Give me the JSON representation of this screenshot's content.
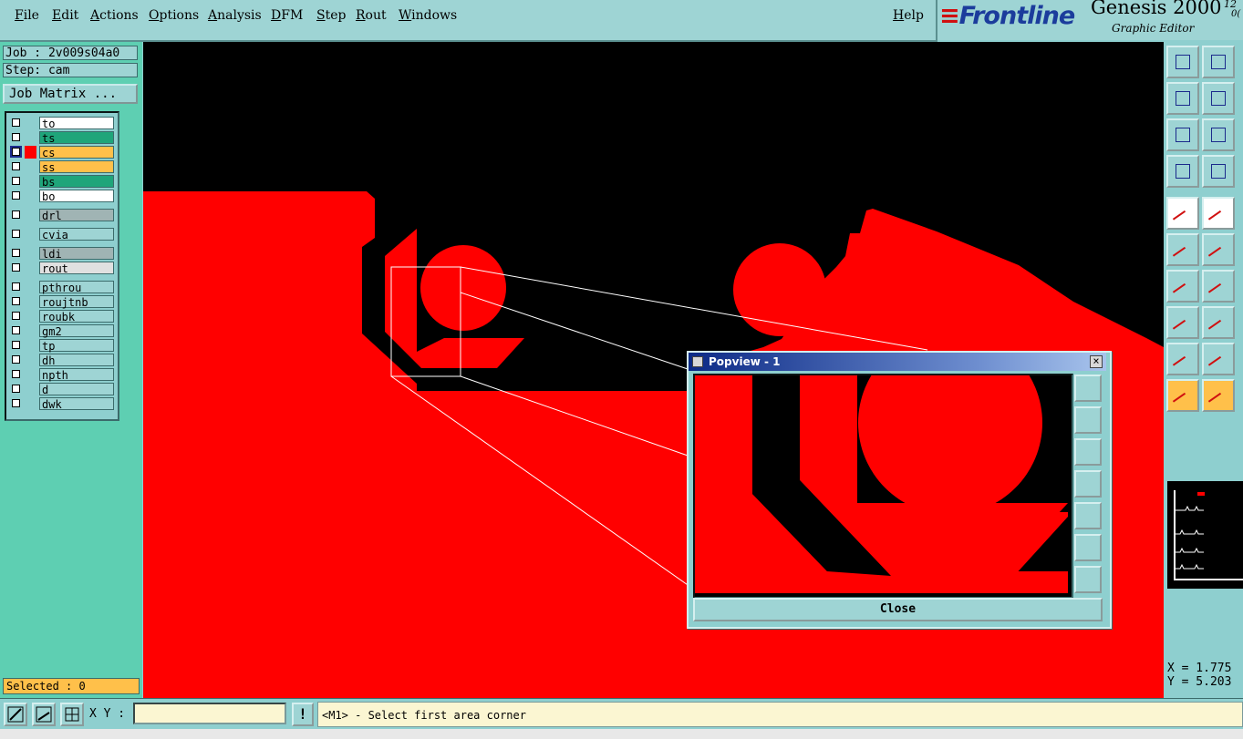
{
  "menu": [
    "File",
    "Edit",
    "Actions",
    "Options",
    "Analysis",
    "DFM",
    "Step",
    "Rout",
    "Windows"
  ],
  "help": "Help",
  "brand": {
    "logo": "Frontline",
    "product": "Genesis 2000",
    "subtitle": "Graphic Editor",
    "version_top": "12",
    "version_bottom": "0("
  },
  "job": {
    "job_line": "Job : 2v009s04a0",
    "step_line": "Step: cam",
    "matrix_button": "Job Matrix ..."
  },
  "layers": [
    {
      "name": "to",
      "color": "#ffffff",
      "active": false
    },
    {
      "name": "ts",
      "color": "#1fa57a",
      "active": false
    },
    {
      "name": "cs",
      "color": "#ffc04a",
      "active": true
    },
    {
      "name": "ss",
      "color": "#ffc04a",
      "active": false
    },
    {
      "name": "bs",
      "color": "#1fa57a",
      "active": false
    },
    {
      "name": "bo",
      "color": "#ffffff",
      "active": false
    },
    {
      "name": "drl",
      "color": "#a0b4b4",
      "active": false
    },
    {
      "name": "cvia",
      "color": "#9ed4d4",
      "active": false
    },
    {
      "name": "ldi",
      "color": "#a0b4b4",
      "active": false
    },
    {
      "name": "rout",
      "color": "#e0e0e0",
      "active": false
    },
    {
      "name": "pthrou",
      "color": "#9ed4d4",
      "active": false
    },
    {
      "name": "roujtnb",
      "color": "#9ed4d4",
      "active": false
    },
    {
      "name": "roubk",
      "color": "#9ed4d4",
      "active": false
    },
    {
      "name": "gm2",
      "color": "#9ed4d4",
      "active": false
    },
    {
      "name": "tp",
      "color": "#9ed4d4",
      "active": false
    },
    {
      "name": "dh",
      "color": "#9ed4d4",
      "active": false
    },
    {
      "name": "npth",
      "color": "#9ed4d4",
      "active": false
    },
    {
      "name": "d",
      "color": "#9ed4d4",
      "active": false
    },
    {
      "name": "dwk",
      "color": "#9ed4d4",
      "active": false
    }
  ],
  "selected": "Selected : 0",
  "coords": {
    "x": "X = 1.775",
    "y": "Y = 5.203"
  },
  "xy_label": "X Y :",
  "xy_value": "",
  "status": "<M1> - Select first area corner",
  "popview": {
    "title": "Popview - 1",
    "close": "Close"
  },
  "colors": {
    "copper": "#ff0000",
    "background": "#000000",
    "panel": "#8ecfcf",
    "active_layer": "#ffc04a"
  },
  "icons": {
    "toolbar": [
      "pan-up-icon",
      "pan-down-icon",
      "pan-left-icon",
      "pan-right-icon",
      "zoom-fit-icon",
      "zoom-home-icon",
      "tools-icon",
      "measure-icon",
      "pad-icon",
      "line-icon",
      "snap-icon",
      "cross-icon",
      "draw-icon",
      "draw-line-icon",
      "select-icon",
      "line-weight-icon",
      "triangle-icon",
      "triangle-layer-icon",
      "arrow-select-icon",
      "arrow-select-box-icon"
    ],
    "popview": [
      "popview-zoom-icon",
      "popview-up-icon",
      "popview-down-icon",
      "popview-left-icon",
      "popview-right-icon",
      "popview-fit-icon",
      "popview-center-icon"
    ]
  }
}
